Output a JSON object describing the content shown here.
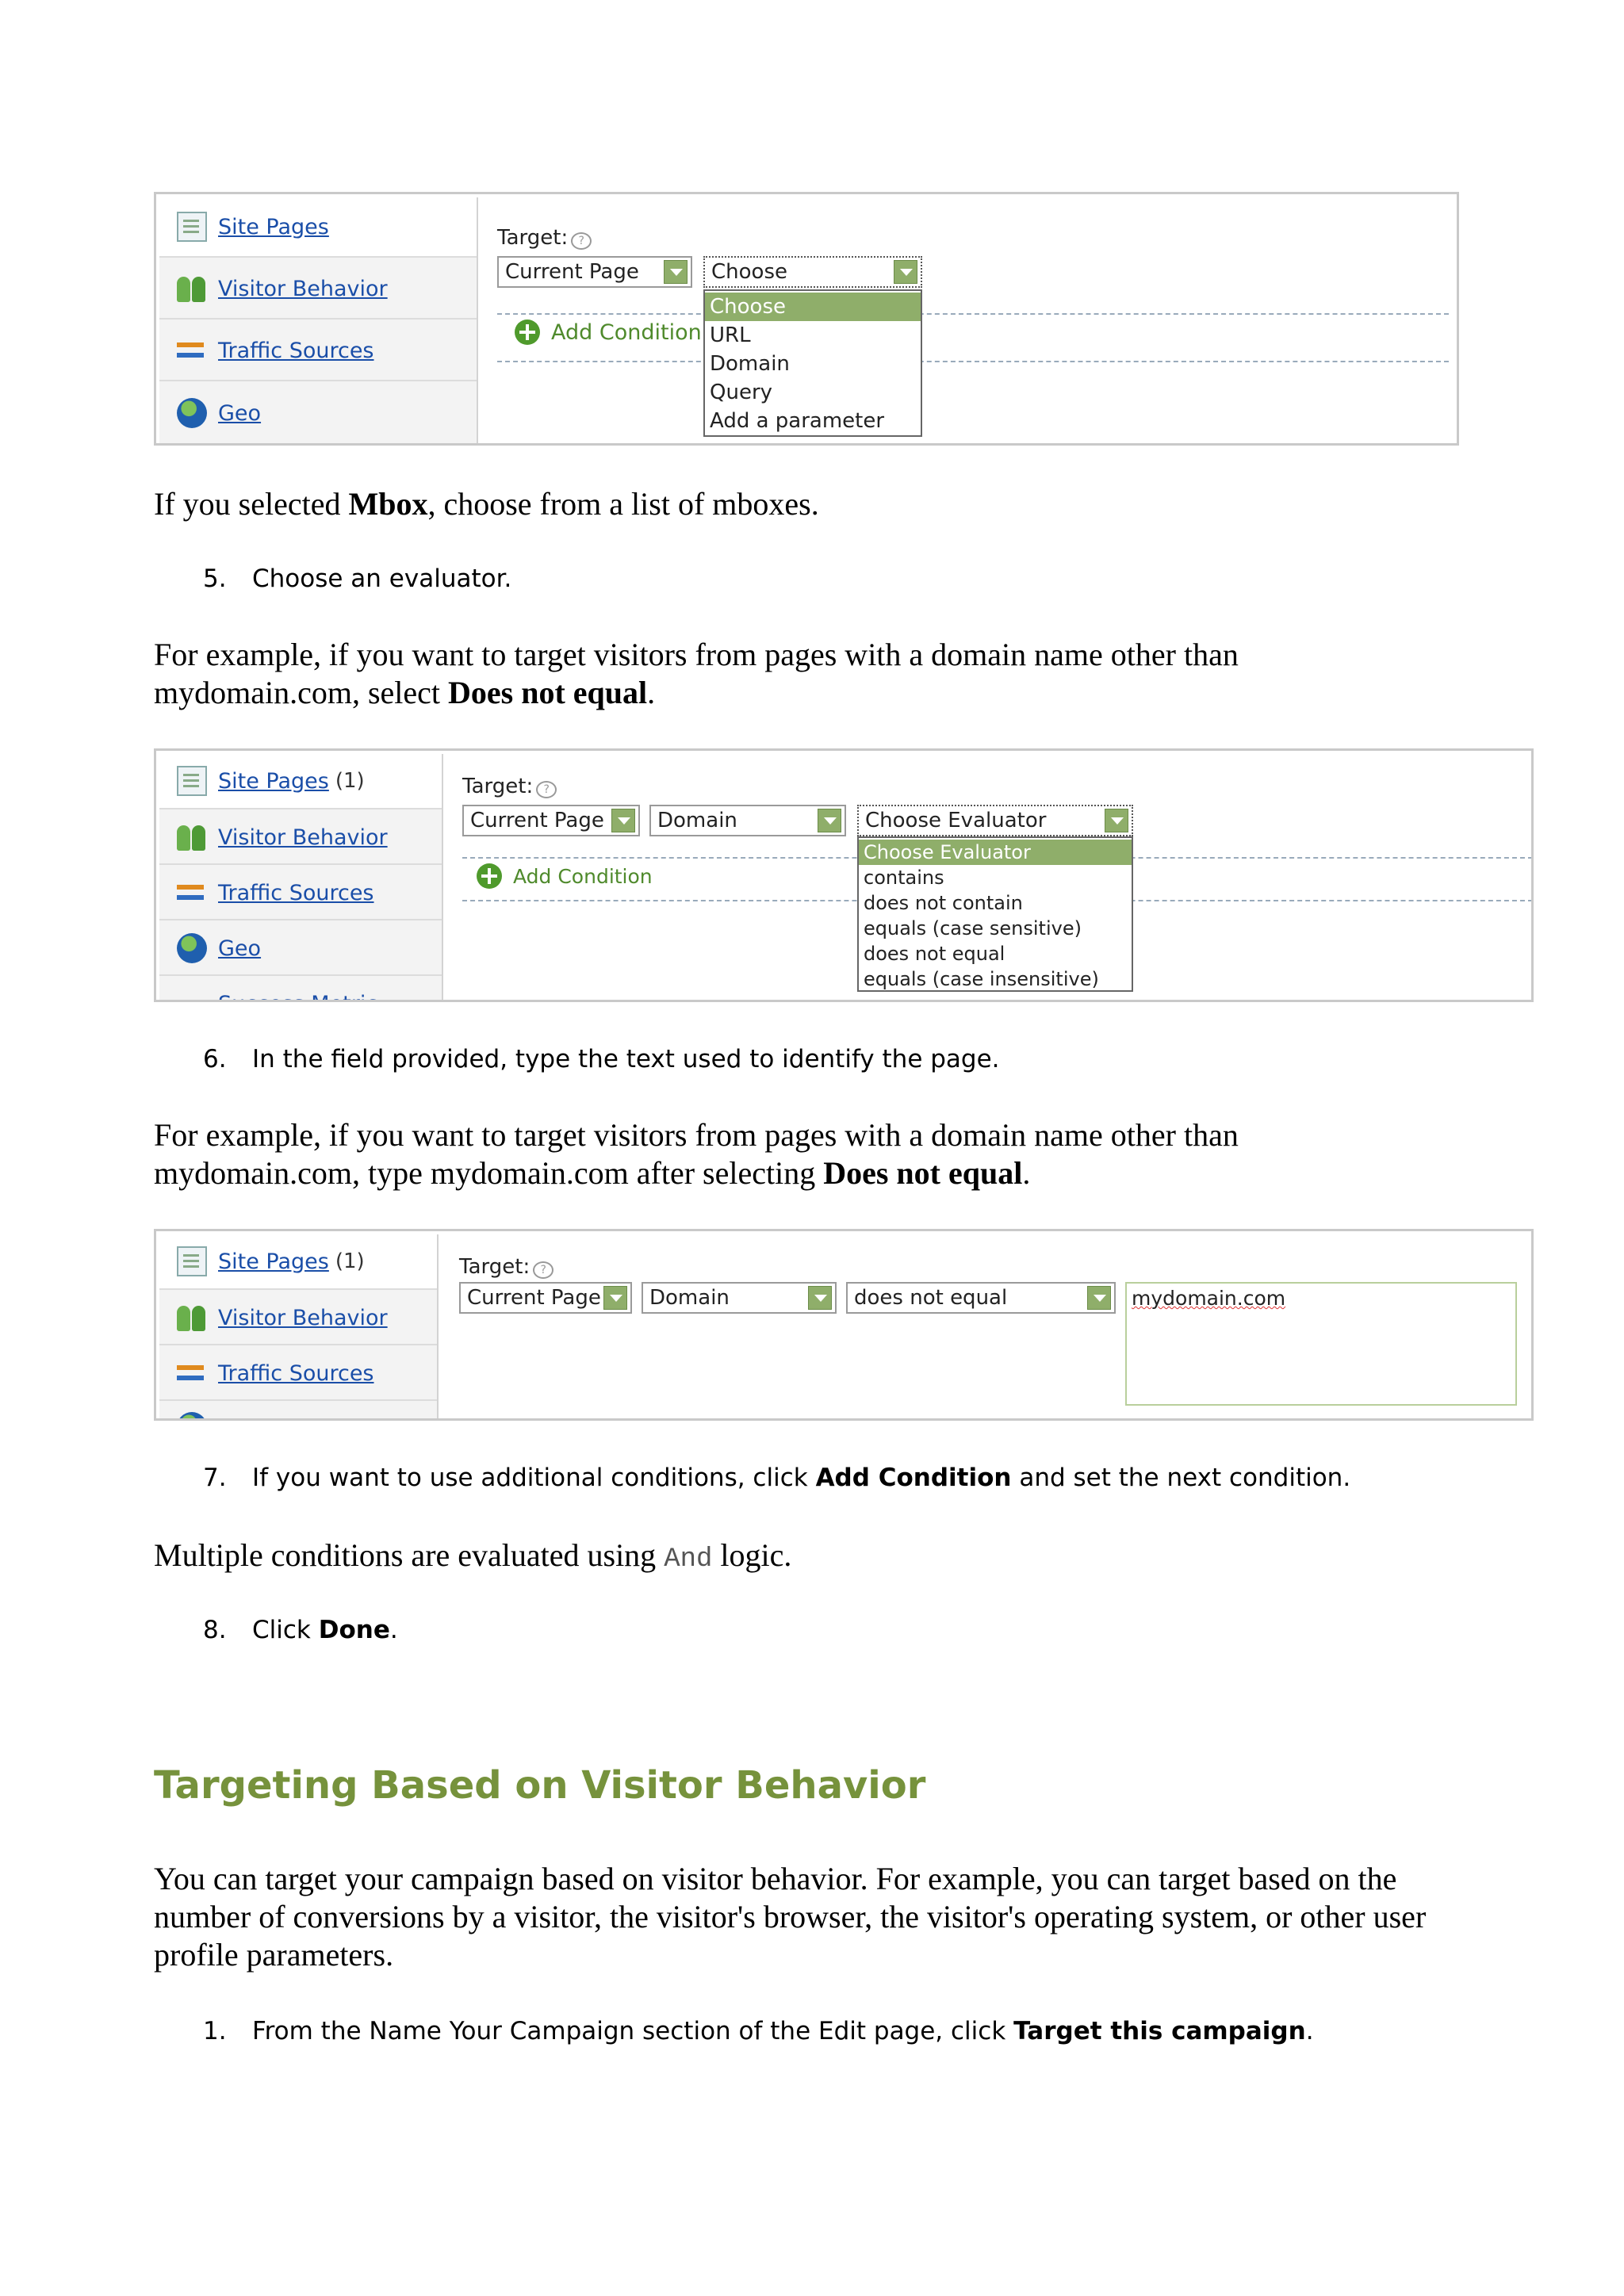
{
  "shot1": {
    "sidebar": [
      {
        "label": "Site Pages",
        "count": ""
      },
      {
        "label": "Visitor Behavior",
        "count": ""
      },
      {
        "label": "Traffic Sources",
        "count": ""
      },
      {
        "label": "Geo",
        "count": ""
      }
    ],
    "target_label": "Target:",
    "select1": "Current Page",
    "select2": "Choose",
    "add_condition": "Add Condition",
    "dropdown": [
      "Choose",
      "URL",
      "Domain",
      "Query",
      "Add a parameter"
    ]
  },
  "para_mbox": {
    "pre": "If you selected ",
    "bold": "Mbox",
    "post": ", choose from a list of mboxes."
  },
  "step5": {
    "num": "5.",
    "text": "Choose an evaluator."
  },
  "para_evaluator": {
    "pre": "For example, if you want to target visitors from pages with a domain name other than mydomain.com, select ",
    "bold": "Does not equal",
    "post": "."
  },
  "shot2": {
    "sidebar": [
      {
        "label": "Site Pages",
        "count": "(1)"
      },
      {
        "label": "Visitor Behavior",
        "count": ""
      },
      {
        "label": "Traffic Sources",
        "count": ""
      },
      {
        "label": "Geo",
        "count": ""
      },
      {
        "label": "Success Metric",
        "count": ""
      }
    ],
    "target_label": "Target:",
    "select1": "Current Page",
    "select2": "Domain",
    "select3": "Choose Evaluator",
    "add_condition": "Add Condition",
    "dropdown": [
      "Choose Evaluator",
      "contains",
      "does not contain",
      "equals (case sensitive)",
      "does not equal",
      "equals (case insensitive)"
    ]
  },
  "step6": {
    "num": "6.",
    "text": "In the field provided, type the text used to identify the page."
  },
  "para_field": {
    "pre": "For example, if you want to target visitors from pages with a domain name other than mydomain.com, type mydomain.com after selecting ",
    "bold": "Does not equal",
    "post": "."
  },
  "shot3": {
    "sidebar": [
      {
        "label": "Site Pages",
        "count": "(1)"
      },
      {
        "label": "Visitor Behavior",
        "count": ""
      },
      {
        "label": "Traffic Sources",
        "count": ""
      }
    ],
    "target_label": "Target:",
    "select1": "Current Page",
    "select2": "Domain",
    "select3": "does not equal",
    "field_value": "mydomain.com"
  },
  "step7": {
    "num": "7.",
    "pre": "If you want to use additional conditions, click ",
    "bold": "Add Condition",
    "post": " and set the next condition."
  },
  "para_logic": {
    "pre": "Multiple conditions are evaluated using ",
    "code": "And",
    "post": " logic."
  },
  "step8": {
    "num": "8.",
    "pre": "Click ",
    "bold": "Done",
    "post": "."
  },
  "section_heading": "Targeting Based on Visitor Behavior",
  "para_behavior": "You can target your campaign based on visitor behavior. For example, you can target based on the number of conversions by a visitor, the visitor's browser, the visitor's operating system, or other user profile parameters.",
  "step1": {
    "num": "1.",
    "pre": "From the Name Your Campaign section of the Edit page, click ",
    "bold": "Target this campaign",
    "post": "."
  }
}
